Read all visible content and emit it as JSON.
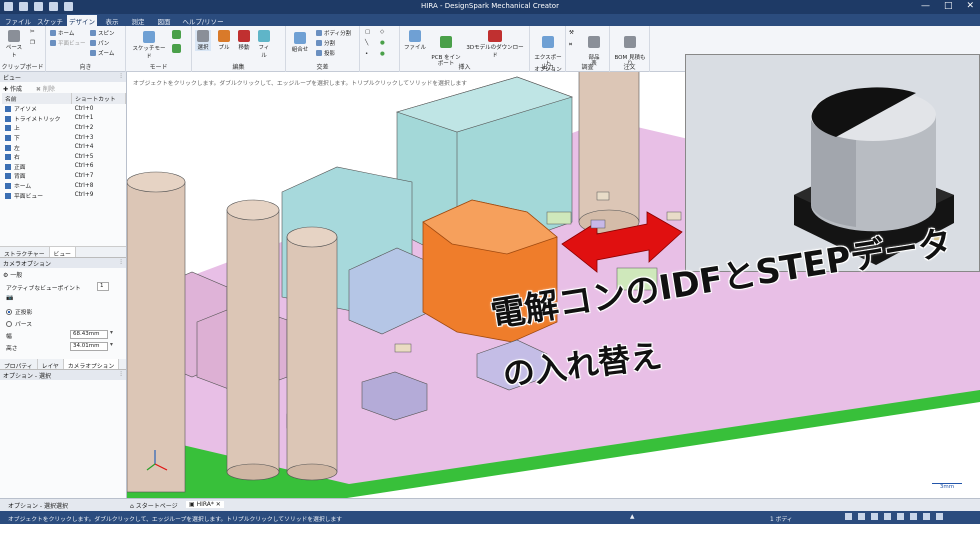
{
  "window": {
    "title": "HIRA - DesignSpark Mechanical Creator",
    "controls": [
      "—",
      "□",
      "✕"
    ]
  },
  "menu": {
    "tabs": [
      "ファイル",
      "スケッチ",
      "デザイン",
      "表示",
      "測定",
      "図面",
      "ヘルプ/リソース"
    ],
    "active": "デザイン"
  },
  "ribbon": {
    "clipboard": {
      "paste": "ペースト",
      "label": "クリップボード"
    },
    "orient": {
      "home": "ホーム",
      "plane_view": "平面ビュー",
      "spin": "スピン",
      "pan": "パン",
      "zoom": "ズーム",
      "label": "向き"
    },
    "mode": {
      "sketch_mode": "スケッチモード",
      "label": "モード"
    },
    "edit": {
      "select": "選択",
      "pull": "プル",
      "move": "移動",
      "fill": "フィル",
      "label": "編集"
    },
    "intersect": {
      "combine": "組合せ",
      "split_body": "ボディ分割",
      "split": "分割",
      "project": "投影",
      "label": "交差"
    },
    "insert": {
      "file": "ファイル",
      "pcb": "PCB をイン\nポート",
      "model_download": "3Dモデルのダウンロード",
      "label": "挿入"
    },
    "output": {
      "export": "エクスポート\nオプション",
      "label": "出力"
    },
    "survey": {
      "parts": "部品\n表",
      "label": "調査"
    },
    "order": {
      "bom": "BOM 見積も\nり",
      "label": "注文"
    }
  },
  "left_panel": {
    "view_title": "ビュー",
    "create": "作成",
    "delete": "削除",
    "table_headers": [
      "名前",
      "ショートカット"
    ],
    "views": [
      {
        "name": "アイソメ",
        "key": "Ctrl+0"
      },
      {
        "name": "トライメトリック",
        "key": "Ctrl+1"
      },
      {
        "name": "上",
        "key": "Ctrl+2"
      },
      {
        "name": "下",
        "key": "Ctrl+3"
      },
      {
        "name": "左",
        "key": "Ctrl+4"
      },
      {
        "name": "右",
        "key": "Ctrl+5"
      },
      {
        "name": "正面",
        "key": "Ctrl+6"
      },
      {
        "name": "背面",
        "key": "Ctrl+7"
      },
      {
        "name": "ホーム",
        "key": "Ctrl+8"
      },
      {
        "name": "平面ビュー",
        "key": "Ctrl+9"
      }
    ],
    "tabs": [
      "ストラクチャー",
      "ビュー"
    ],
    "camera_options": "カメラオプション",
    "general": "一般",
    "active_view_point": "アクティブなビューポイント",
    "active_view_point_value": "1",
    "projection_ortho": "正投影",
    "projection_persp": "パース",
    "width_label": "幅",
    "width_value": "68.43mm",
    "height_label": "高さ",
    "height_value": "34.01mm",
    "prop_tabs": [
      "プロパティ",
      "レイヤ",
      "カメラオプション"
    ],
    "options_select": "オプション - 選択"
  },
  "viewport": {
    "hint": "オブジェクトをクリックします。ダブルクリックして、エッジループを選択します。トリプルクリックしてソリッドを選択します",
    "scale": "3mm",
    "caption_line1": "電解コンのIDFとSTEPデータ",
    "caption_line2": "の入れ替え"
  },
  "bottom_tabs": {
    "left1": "オプション - 選択",
    "left2": "選択",
    "start_page": "スタートページ",
    "doc": "HIRA*"
  },
  "status": {
    "message": "オブジェクトをクリックします。ダブルクリックして、エッジループを選択します。トリプルクリックしてソリッドを選択します",
    "bodies": "1 ボディ"
  },
  "colors": {
    "title_bar": "#1e3a66",
    "board": "#e8bfe6",
    "board_edge": "#3cbf3c",
    "highlight": "#ef7d2b",
    "arrow": "#e01010"
  }
}
